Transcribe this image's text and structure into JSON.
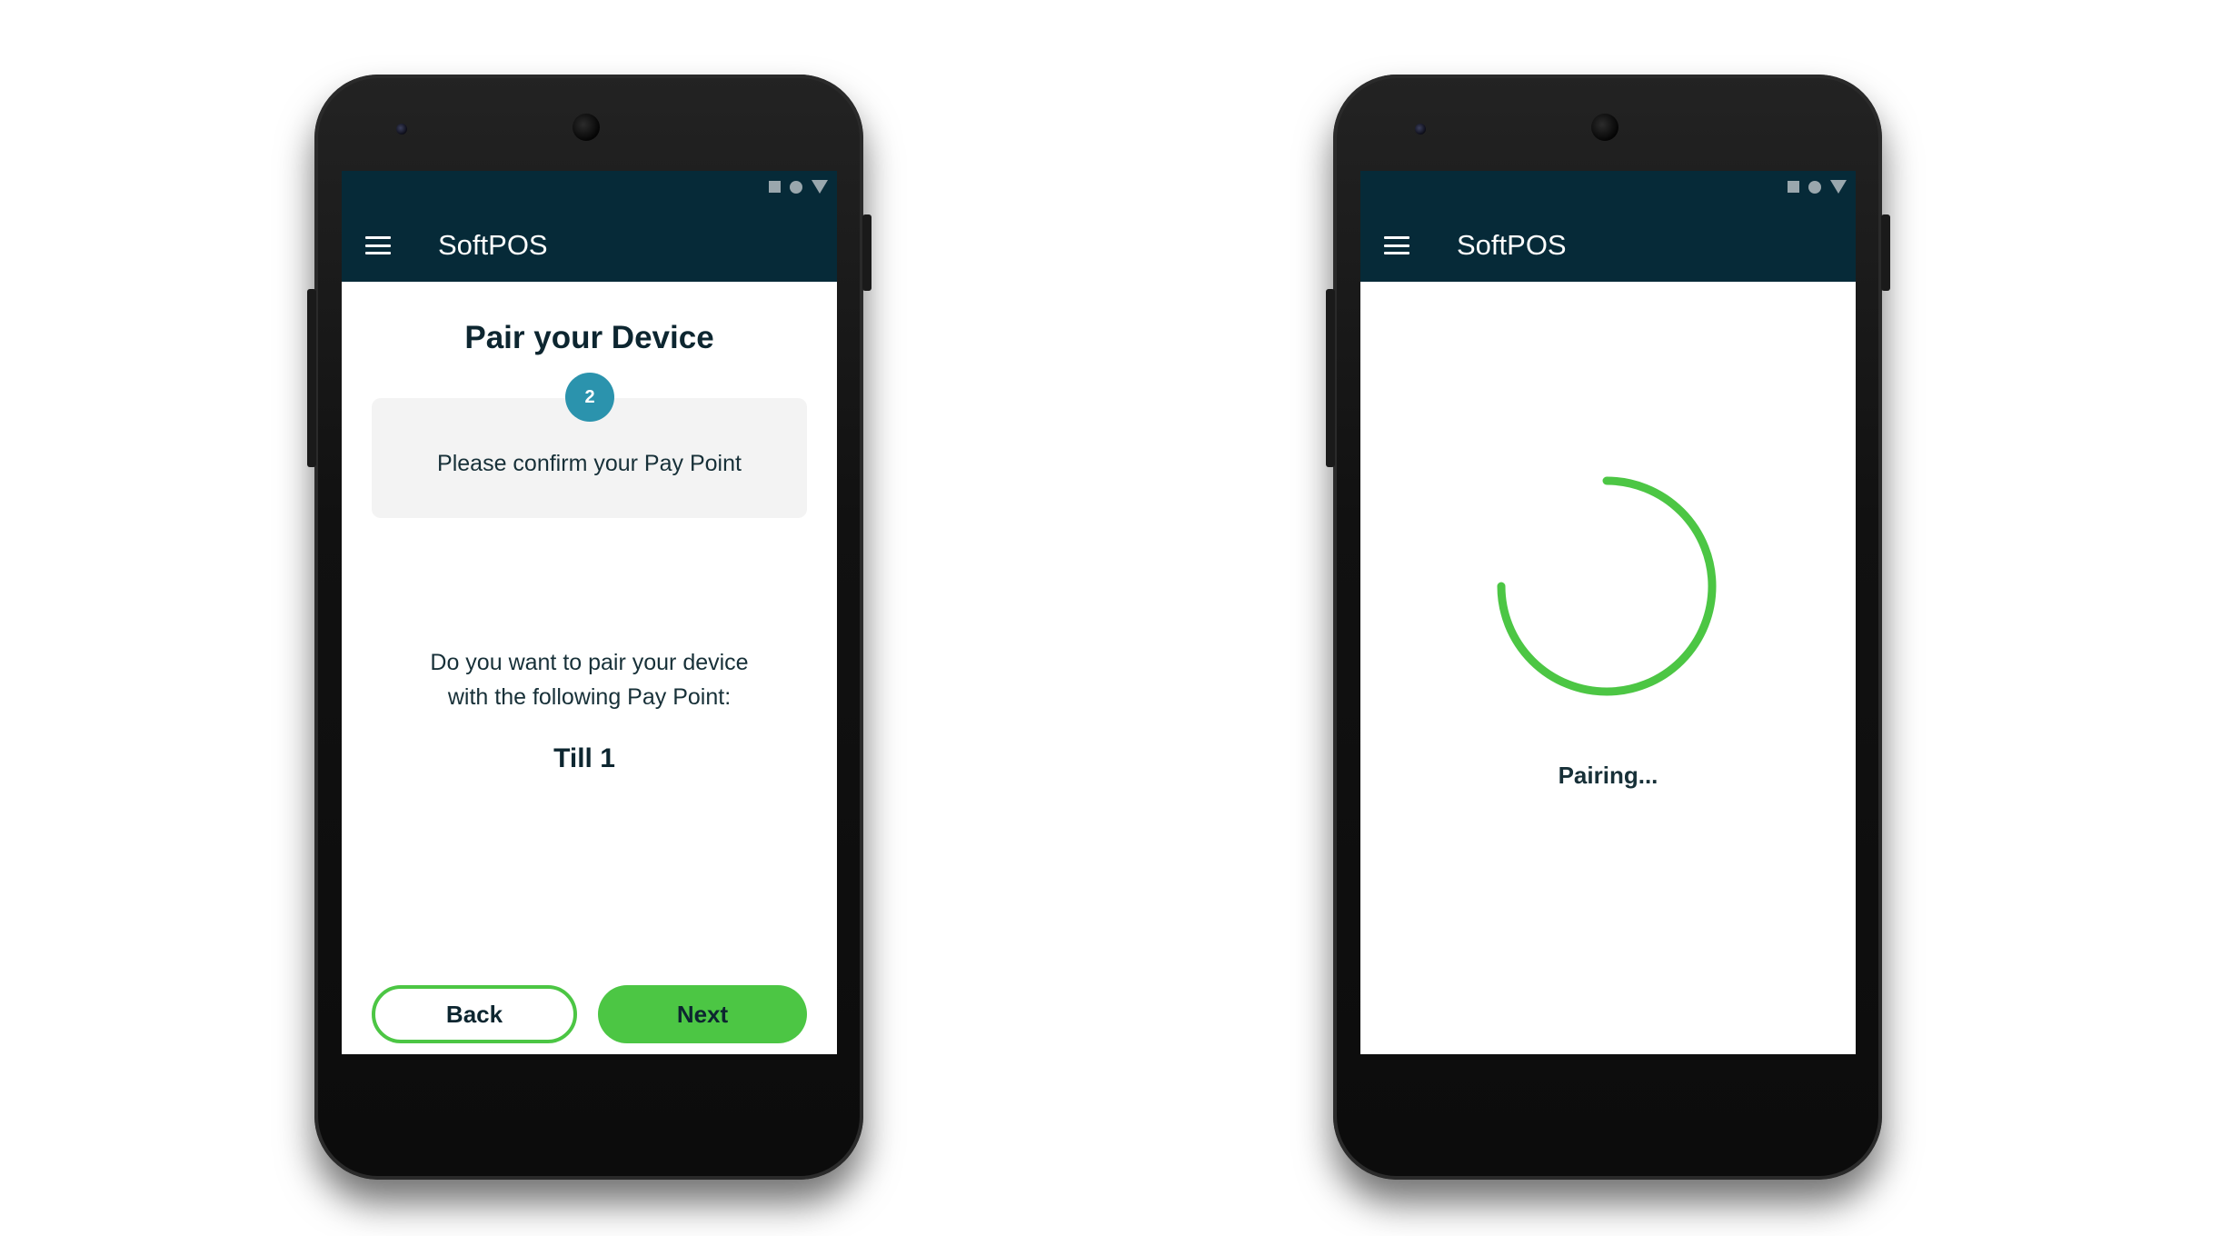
{
  "colors": {
    "appbar": "#062a38",
    "accent_green": "#4cc644",
    "step_badge": "#2b93ad",
    "text_dark": "#0d2630"
  },
  "left_phone": {
    "app_title": "SoftPOS",
    "page_title": "Pair your Device",
    "step_number": "2",
    "step_text": "Please confirm your Pay Point",
    "question_line1": "Do you want to pair your device",
    "question_line2": "with the following Pay Point:",
    "pay_point": "Till 1",
    "back_label": "Back",
    "next_label": "Next"
  },
  "right_phone": {
    "app_title": "SoftPOS",
    "status_text": "Pairing...",
    "spinner_progress": 0.75
  },
  "icons": {
    "menu": "hamburger-menu-icon",
    "status_square": "square-status-icon",
    "status_circle": "circle-status-icon",
    "status_signal": "signal-triangle-icon"
  }
}
